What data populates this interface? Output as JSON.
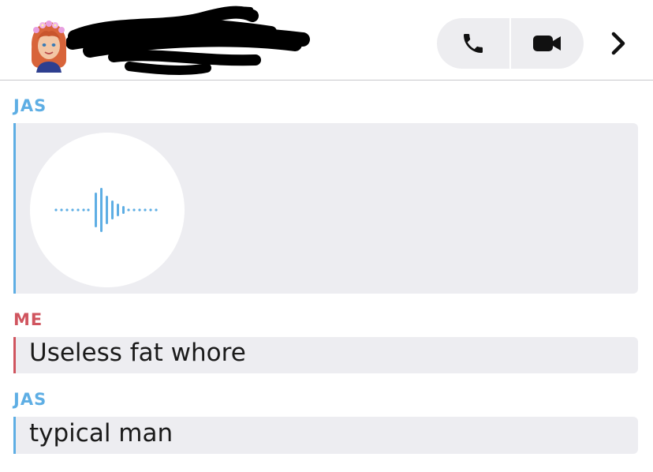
{
  "header": {
    "call_icon": "phone-icon",
    "video_icon": "video-camera-icon",
    "more_icon": "chevron-right-icon"
  },
  "colors": {
    "friend": "#5eaee4",
    "me": "#d0555f",
    "bubble_bg": "#ededf1",
    "call_bg": "#ededf0"
  },
  "messages": [
    {
      "sender": "JAS",
      "type": "voice-note"
    },
    {
      "sender": "ME",
      "type": "text",
      "text": "Useless fat whore"
    },
    {
      "sender": "JAS",
      "type": "text",
      "text": "typical man"
    }
  ]
}
